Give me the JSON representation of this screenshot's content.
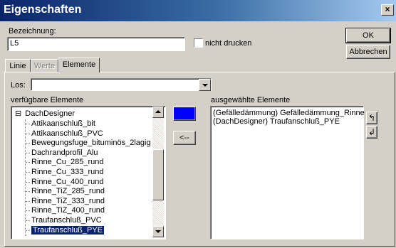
{
  "window": {
    "title": "Eigenschaften",
    "close_glyph": "×"
  },
  "form": {
    "bezeichnung_label": "Bezeichnung:",
    "bezeichnung_value": "L5",
    "nicht_drucken_label": "nicht drucken",
    "nicht_drucken_checked": false,
    "ok_label": "OK",
    "abbrechen_label": "Abbrechen"
  },
  "tabs": [
    {
      "label": "Linie",
      "active": false,
      "enabled": true
    },
    {
      "label": "Werte",
      "active": false,
      "enabled": false
    },
    {
      "label": "Elemente",
      "active": true,
      "enabled": true
    }
  ],
  "elemente": {
    "los_label": "Los:",
    "los_value": "",
    "verfuegbar_label": "verfügbare Elemente",
    "ausgewaehlt_label": "ausgewählte Elemente",
    "tree_root": "DachDesigner",
    "tree_root_toggle": "⊟",
    "tree_items": [
      "Attikaanschluß_bit",
      "Attikaanschluß_PVC",
      "Bewegungsfuge_bituminös_2lagig",
      "Dachrandprofil_Alu",
      "Rinne_Cu_285_rund",
      "Rinne_Cu_333_rund",
      "Rinne_Cu_400_rund",
      "Rinne_TiZ_285_rund",
      "Rinne_TiZ_333_rund",
      "Rinne_TiZ_400_rund",
      "Traufanschluß_PVC",
      "Traufanschluß_PYE"
    ],
    "tree_selected_index": 11,
    "add_button_label": "-->",
    "remove_button_label": "<--",
    "selected_items": [
      "(Gefälledämmung) Gefälledämmung_Rinne",
      "(DachDesigner) Traufanschluß_PYE"
    ],
    "move_up_glyph": "↰",
    "move_down_glyph": "↲",
    "accent_color": "#0a246a",
    "add_button_color": "#0000ff"
  }
}
